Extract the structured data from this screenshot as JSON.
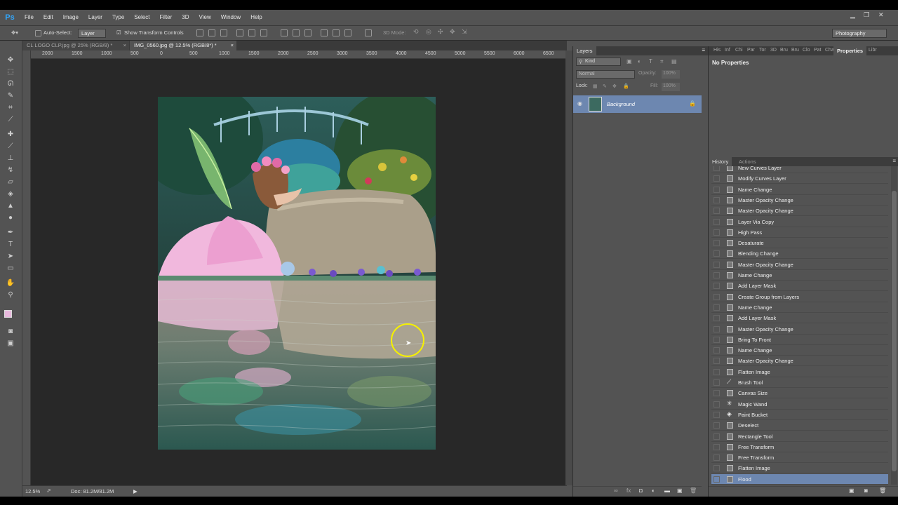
{
  "app": {
    "logo": "Ps"
  },
  "menu": [
    "File",
    "Edit",
    "Image",
    "Layer",
    "Type",
    "Select",
    "Filter",
    "3D",
    "View",
    "Window",
    "Help"
  ],
  "window_controls": {
    "minimize": "▁",
    "restore": "❐",
    "close": "✕"
  },
  "options_bar": {
    "auto_select_label": "Auto-Select:",
    "auto_select_value": "Layer",
    "show_transform_label": "Show Transform Controls",
    "mode_3d_label": "3D Mode:",
    "workspace": "Photography"
  },
  "doc_tabs": [
    {
      "label": "CL LOGO CLP.jpg @ 25% (RGB/8) *",
      "close": "×"
    },
    {
      "label": "IMG_0560.jpg @ 12.5% (RGB/8*) *",
      "close": "×"
    }
  ],
  "ruler_labels": [
    "2000",
    "1500",
    "1000",
    "500",
    "0",
    "500",
    "1000",
    "1500",
    "2000",
    "2500",
    "3000",
    "3500",
    "4000",
    "4500",
    "5000",
    "5500",
    "6000",
    "6500"
  ],
  "status": {
    "zoom": "12.5%",
    "doc_size": "Doc: 81.2M/81.2M"
  },
  "layers": {
    "title": "Layers",
    "kind_label": "Kind",
    "blend_mode": "Normal",
    "opacity_label": "Opacity:",
    "opacity_value": "100%",
    "lock_label": "Lock:",
    "fill_label": "Fill:",
    "fill_value": "100%",
    "items": [
      {
        "name": "Background"
      }
    ]
  },
  "right_tabs": [
    "His",
    "Inf",
    "Chi",
    "Par",
    "Tor",
    "3D",
    "Bru",
    "Bru",
    "Clo",
    "Pat",
    "Cha",
    "Properties",
    "Libr"
  ],
  "properties_text": "No Properties",
  "history_tabs": [
    "History",
    "Actions"
  ],
  "history": [
    {
      "label": "New Curves Layer",
      "icon": "doc-icon"
    },
    {
      "label": "Modify Curves Layer",
      "icon": "doc-icon"
    },
    {
      "label": "Name Change",
      "icon": "doc-icon"
    },
    {
      "label": "Master Opacity Change",
      "icon": "doc-icon"
    },
    {
      "label": "Master Opacity Change",
      "icon": "doc-icon"
    },
    {
      "label": "Layer Via Copy",
      "icon": "doc-icon"
    },
    {
      "label": "High Pass",
      "icon": "doc-icon"
    },
    {
      "label": "Desaturate",
      "icon": "doc-icon"
    },
    {
      "label": "Blending Change",
      "icon": "doc-icon"
    },
    {
      "label": "Master Opacity Change",
      "icon": "doc-icon"
    },
    {
      "label": "Name Change",
      "icon": "doc-icon"
    },
    {
      "label": "Add Layer Mask",
      "icon": "doc-icon"
    },
    {
      "label": "Create Group from Layers",
      "icon": "doc-icon"
    },
    {
      "label": "Name Change",
      "icon": "doc-icon"
    },
    {
      "label": "Add Layer Mask",
      "icon": "doc-icon"
    },
    {
      "label": "Master Opacity Change",
      "icon": "doc-icon"
    },
    {
      "label": "Bring To Front",
      "icon": "doc-icon"
    },
    {
      "label": "Name Change",
      "icon": "doc-icon"
    },
    {
      "label": "Master Opacity Change",
      "icon": "doc-icon"
    },
    {
      "label": "Flatten Image",
      "icon": "doc-icon"
    },
    {
      "label": "Brush Tool",
      "icon": "brush-icon"
    },
    {
      "label": "Canvas Size",
      "icon": "doc-icon"
    },
    {
      "label": "Magic Wand",
      "icon": "wand-icon"
    },
    {
      "label": "Paint Bucket",
      "icon": "bucket-icon"
    },
    {
      "label": "Deselect",
      "icon": "doc-icon"
    },
    {
      "label": "Rectangle Tool",
      "icon": "doc-icon"
    },
    {
      "label": "Free Transform",
      "icon": "doc-icon"
    },
    {
      "label": "Free Transform",
      "icon": "doc-icon"
    },
    {
      "label": "Flatten Image",
      "icon": "doc-icon"
    },
    {
      "label": "Flood",
      "icon": "doc-icon"
    }
  ],
  "colors": {
    "selection": "#6d87b0",
    "accent": "#31a8ff",
    "cursor_ring": "#f5f000"
  }
}
